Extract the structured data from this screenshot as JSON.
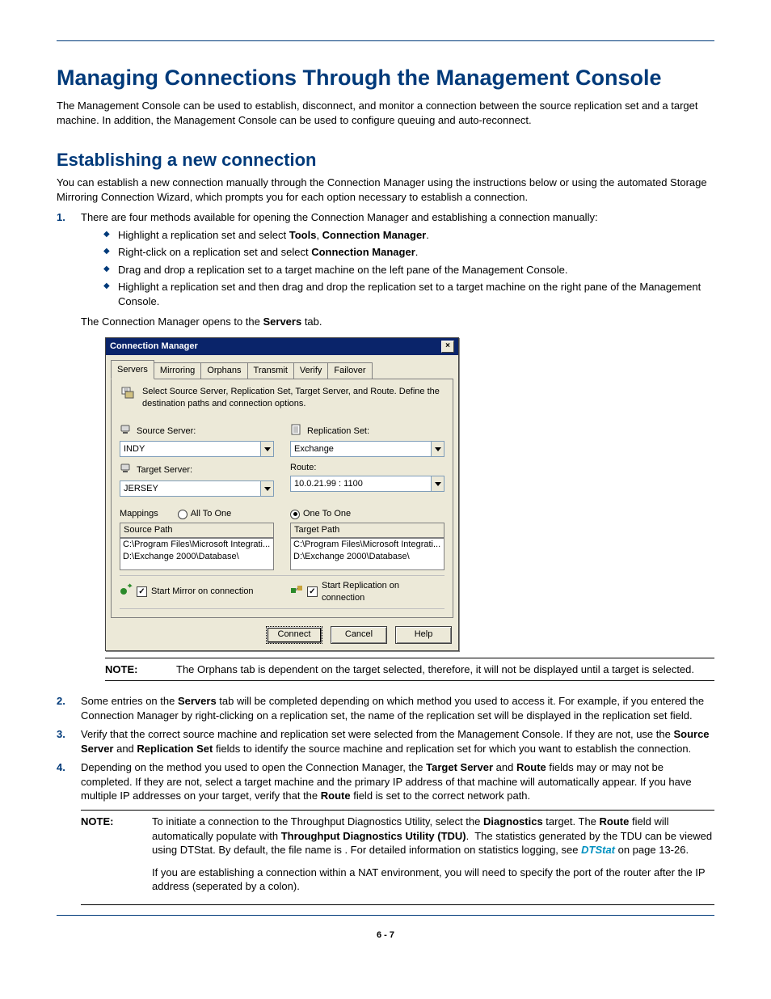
{
  "page_number": "6 - 7",
  "headings": {
    "h1": "Managing Connections Through the Management Console",
    "h2": "Establishing a new connection"
  },
  "paras": {
    "intro": "The Management Console can be used to establish, disconnect, and monitor a connection between the source replication set and a target machine. In addition, the Management Console can be used to configure queuing and auto-reconnect.",
    "section_intro": "You can establish a new connection manually through the Connection Manager using the instructions below or using the automated Storage Mirroring Connection Wizard, which prompts you for each option necessary to establish a connection."
  },
  "steps": [
    {
      "num": "1.",
      "text": "There are four methods available for opening the Connection Manager and establishing a connection manually:",
      "bullets": [
        {
          "bold1": "Tools",
          "bold2": "Connection Manager"
        },
        {
          "bold1": "Connection Manager"
        },
        {
          "text": "Drag and drop a replication set to a target machine on the left pane of the Management Console."
        },
        {
          "text": "Highlight a replication set and then drag and drop the replication set to a target machine on the right pane of the Management Console."
        }
      ],
      "trailer_bold": "Servers"
    },
    {
      "num": "2.",
      "bold1": "Servers"
    },
    {
      "num": "3.",
      "bold1": "Source Server",
      "bold2": "Replication Set"
    },
    {
      "num": "4.",
      "bold1": "Target Server",
      "bold2": "Route",
      "bold3": "Route"
    }
  ],
  "dialog": {
    "title": "Connection Manager",
    "tabs": [
      "Servers",
      "Mirroring",
      "Orphans",
      "Transmit",
      "Verify",
      "Failover"
    ],
    "hint": "Select Source Server, Replication Set, Target Server, and Route.  Define the destination paths and connection options.",
    "fields": {
      "source_server": {
        "label": "Source Server:",
        "value": "INDY"
      },
      "target_server": {
        "label": "Target Server:",
        "value": "JERSEY"
      },
      "replication_set": {
        "label": "Replication Set:",
        "value": "Exchange"
      },
      "route": {
        "label": "Route:",
        "value": "10.0.21.99 : 1100"
      }
    },
    "mappings": {
      "label": "Mappings",
      "options": [
        "All To One",
        "One To One"
      ],
      "selected": "One To One",
      "columns": [
        "Source Path",
        "Target Path"
      ],
      "source_rows": [
        "C:\\Program Files\\Microsoft Integrati...",
        "D:\\Exchange 2000\\Database\\"
      ],
      "target_rows": [
        "C:\\Program Files\\Microsoft Integrati...",
        "D:\\Exchange 2000\\Database\\"
      ]
    },
    "checks": {
      "start_mirror": "Start Mirror on connection",
      "start_replication": "Start Replication on connection"
    },
    "buttons": [
      "Connect",
      "Cancel",
      "Help"
    ]
  },
  "notes": {
    "label": "NOTE:",
    "n1": "The Orphans tab is dependent on the target selected, therefore, it will not be displayed until a target is selected.",
    "n2": {
      "bold1": "Diagnostics",
      "bold2": "Route",
      "bold3": "Throughput Diagnostics Utility (TDU)",
      "blank": "                                    ",
      "link": "DTStat",
      "page": "13-26",
      "p2": "If you are establishing a connection within a NAT environment, you will need to specify the port of the router after the IP address (seperated by a colon)."
    }
  }
}
